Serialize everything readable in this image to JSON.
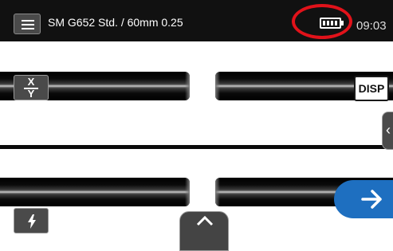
{
  "status_bar": {
    "menu_icon": "hamburger-menu-icon",
    "fiber_profile": "SM G652 Std. / 60mm 0.25",
    "battery_icon": "battery-full-icon",
    "battery_segments": 4,
    "time": "09:03",
    "highlight_color": "#e1121a"
  },
  "view_controls": {
    "xy_toggle": {
      "top": "X",
      "bottom": "Y"
    },
    "display_button": "DISP",
    "side_panel_icon": "chevron-left-icon"
  },
  "actions": {
    "arc_icon": "lightning-bolt-icon",
    "next_icon": "arrow-right-icon",
    "bottom_tab_icon": "chevron-up-icon",
    "accent_color": "#1e6fc0"
  }
}
